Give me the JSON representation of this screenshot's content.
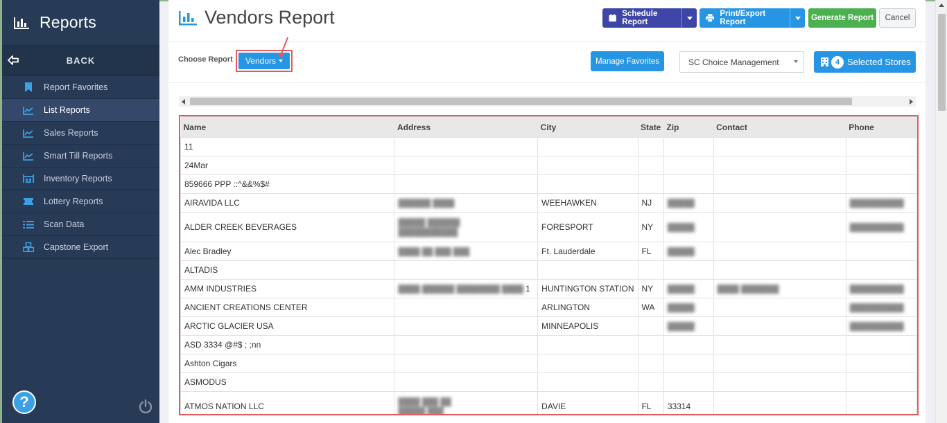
{
  "sidebar": {
    "title": "Reports",
    "back_label": "BACK",
    "items": [
      {
        "label": "Report Favorites",
        "icon": "bookmark-icon"
      },
      {
        "label": "List Reports",
        "icon": "chart-line-icon",
        "active": true
      },
      {
        "label": "Sales Reports",
        "icon": "chart-line-icon"
      },
      {
        "label": "Smart Till Reports",
        "icon": "chart-line-icon"
      },
      {
        "label": "Inventory Reports",
        "icon": "warehouse-icon"
      },
      {
        "label": "Lottery Reports",
        "icon": "ticket-icon"
      },
      {
        "label": "Scan Data",
        "icon": "list-icon"
      },
      {
        "label": "Capstone Export",
        "icon": "boxes-icon"
      }
    ],
    "help_label": "?"
  },
  "header": {
    "title": "Vendors Report",
    "schedule_label": "Schedule Report",
    "print_label": "Print/Export Report",
    "generate_label": "Generate Report",
    "cancel_label": "Cancel"
  },
  "controls": {
    "choose_label": "Choose Report",
    "report_selected": "Vendors",
    "manage_favorites_label": "Manage Favorites",
    "store_group": "SC Choice Management",
    "selected_stores_count": "4",
    "selected_stores_label": "Selected Stores"
  },
  "table": {
    "columns": [
      "Name",
      "Address",
      "City",
      "State",
      "Zip",
      "Contact",
      "Phone"
    ],
    "rows": [
      {
        "name": "11",
        "address": "",
        "city": "",
        "state": "",
        "zip": "",
        "contact": "",
        "phone": ""
      },
      {
        "name": "24Mar",
        "address": "",
        "city": "",
        "state": "",
        "zip": "",
        "contact": "",
        "phone": ""
      },
      {
        "name": "859666 PPP ::^&&%$#",
        "address": "",
        "city": "",
        "state": "",
        "zip": "",
        "contact": "",
        "phone": ""
      },
      {
        "name": "AIRAVIDA LLC",
        "address": "",
        "city": "WEEHAWKEN",
        "state": "NJ",
        "zip": "",
        "contact": "",
        "phone": ""
      },
      {
        "name": "ALDER CREEK BEVERAGES",
        "address": "",
        "city": "FORESPORT",
        "state": "NY",
        "zip": "",
        "contact": "",
        "phone": ""
      },
      {
        "name": "Alec Bradley",
        "address": "",
        "city": "Ft. Lauderdale",
        "state": "FL",
        "zip": "",
        "contact": "",
        "phone": ""
      },
      {
        "name": "ALTADIS",
        "address": "",
        "city": "",
        "state": "",
        "zip": "",
        "contact": "",
        "phone": ""
      },
      {
        "name": "AMM INDUSTRIES",
        "address": "1",
        "city": "HUNTINGTON STATION",
        "state": "NY",
        "zip": "",
        "contact": "",
        "phone": ""
      },
      {
        "name": "ANCIENT CREATIONS CENTER",
        "address": "",
        "city": "ARLINGTON",
        "state": "WA",
        "zip": "",
        "contact": "",
        "phone": ""
      },
      {
        "name": "ARCTIC GLACIER USA",
        "address": "",
        "city": "MINNEAPOLIS",
        "state": "",
        "zip": "",
        "contact": "",
        "phone": ""
      },
      {
        "name": "ASD 3334 @#$ ; ;nn",
        "address": "",
        "city": "",
        "state": "",
        "zip": "",
        "contact": "",
        "phone": ""
      },
      {
        "name": "Ashton Cigars",
        "address": "",
        "city": "",
        "state": "",
        "zip": "",
        "contact": "",
        "phone": ""
      },
      {
        "name": "ASMODUS",
        "address": "",
        "city": "",
        "state": "",
        "zip": "",
        "contact": "",
        "phone": ""
      },
      {
        "name": "ATMOS NATION LLC",
        "address": "",
        "city": "DAVIE",
        "state": "FL",
        "zip": "33314",
        "contact": "",
        "phone": ""
      }
    ]
  },
  "colors": {
    "sidebar_bg": "#273a56",
    "primary_blue": "#2696e4",
    "schedule_indigo": "#3d46a6",
    "generate_green": "#4caf50",
    "highlight_red": "#e35b5b"
  }
}
